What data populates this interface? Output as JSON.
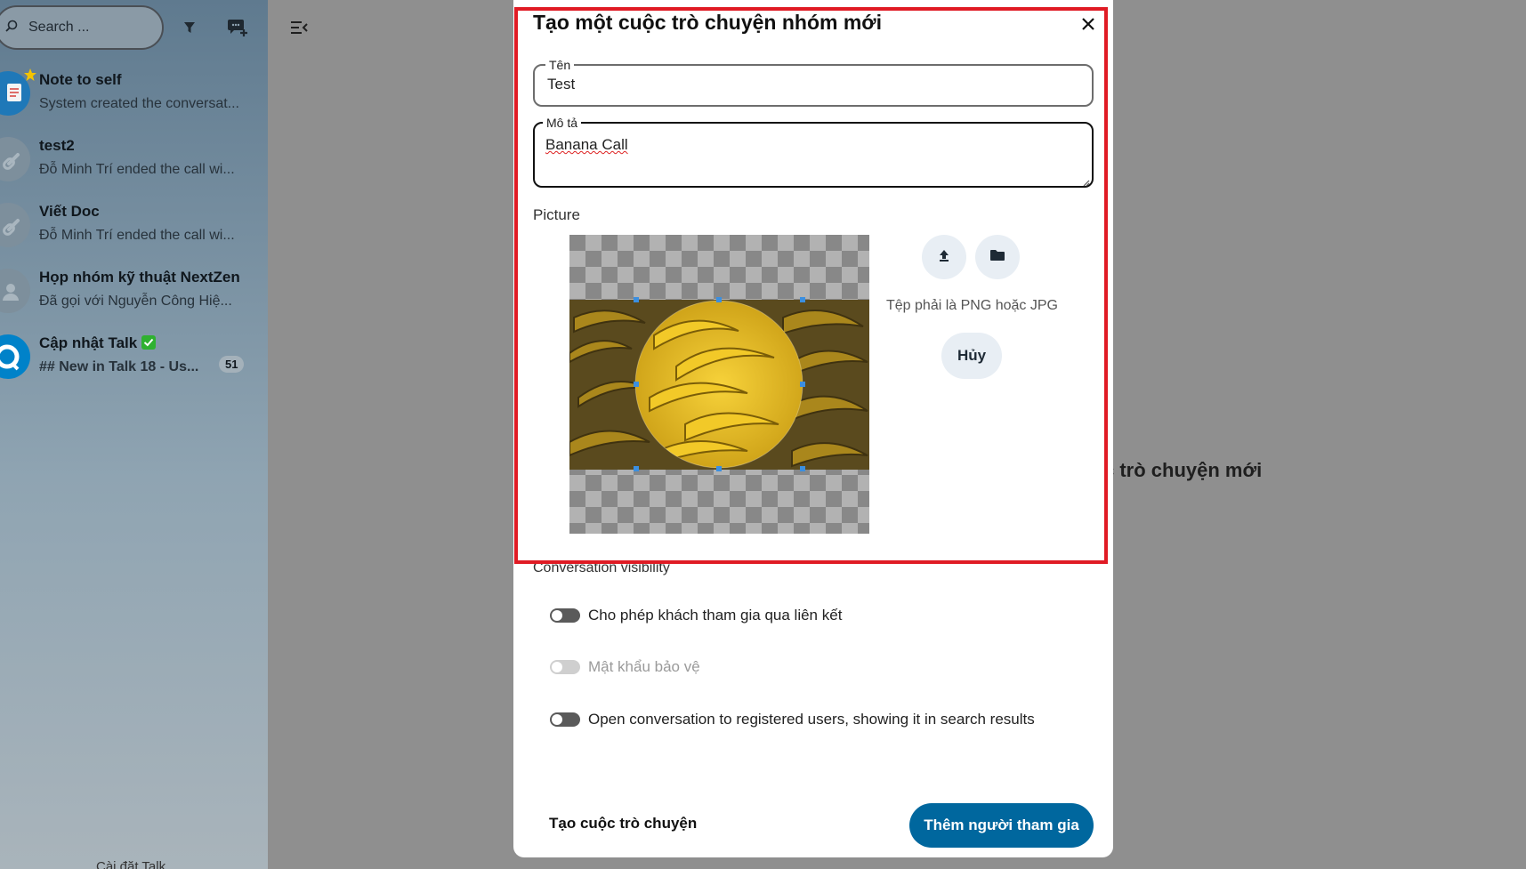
{
  "sidebar": {
    "search_placeholder": "Search ...",
    "conversations": [
      {
        "title": "Note to self",
        "subtitle": "System created the conversat...",
        "avatar_icon": "notepad-icon",
        "favorite": true
      },
      {
        "title": "test2",
        "subtitle": "Đỗ Minh Trí ended the call wi...",
        "avatar_icon": "link-icon"
      },
      {
        "title": "Viết Doc",
        "subtitle": "Đỗ Minh Trí ended the call wi...",
        "avatar_icon": "link-icon"
      },
      {
        "title": "Họp nhóm kỹ thuật NextZen",
        "subtitle": "Đã gọi với Nguyễn Công Hiệ...",
        "avatar_icon": "group-icon"
      },
      {
        "title": "Cập nhật Talk",
        "subtitle": "## New in Talk 18 - Us...",
        "avatar_icon": "talk-logo-icon",
        "verified": true,
        "unread": "51"
      }
    ],
    "footer": "Cài đặt Talk"
  },
  "background_heading": "c trò chuyện mới",
  "modal": {
    "title": "Tạo một cuộc trò chuyện nhóm mới",
    "name_label": "Tên",
    "name_value": "Test",
    "description_label": "Mô tả",
    "description_value": "Banana Call",
    "picture_label": "Picture",
    "file_hint": "Tệp phải là PNG hoặc JPG",
    "cancel_label": "Hủy",
    "visibility_label": "Conversation visibility",
    "toggles": [
      {
        "label": "Cho phép khách tham gia qua liên kết",
        "enabled": false,
        "disabled": false
      },
      {
        "label": "Mật khẩu bảo vệ",
        "enabled": false,
        "disabled": true
      },
      {
        "label": "Open conversation to registered users, showing it in search results",
        "enabled": false,
        "disabled": false
      }
    ],
    "create_label": "Tạo cuộc trò chuyện",
    "add_participants_label": "Thêm người tham gia"
  },
  "colors": {
    "highlight": "#e01b24",
    "primary": "#00679e",
    "verified": "#2fb130",
    "favorite": "#f5c400"
  }
}
